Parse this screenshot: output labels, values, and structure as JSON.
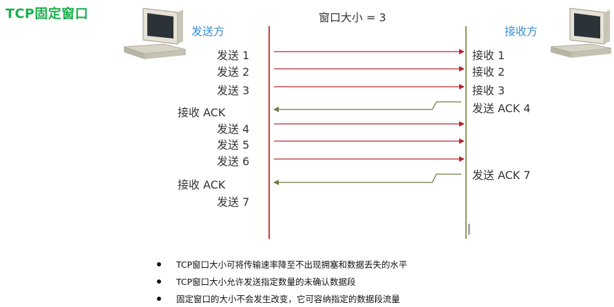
{
  "title": "TCP固定窗口",
  "sender": "发送方",
  "receiver": "接收方",
  "window_label": "窗口大小 = 3",
  "sender_labels": [
    "发送 1",
    "发送 2",
    "发送 3",
    "接收 ACK",
    "发送 4",
    "发送 5",
    "发送 6",
    "接收 ACK",
    "发送 7"
  ],
  "receiver_labels": [
    "接收 1",
    "接收 2",
    "接收 3",
    "发送 ACK 4",
    "发送 ACK 7"
  ],
  "bullets": [
    "TCP窗口大小可将传输速率降至不出现拥塞和数据丢失的水平",
    "TCP窗口大小允许发送指定数量的未确认数据段",
    "固定窗口的大小不会发生改变，它可容纳指定的数据段流量"
  ],
  "colors": {
    "title": "#17b04a",
    "role": "#3a8fd0",
    "sender_line": "#c43a3a",
    "receiver_line": "#8a9a5e",
    "data_arrow": "#b8242c",
    "ack_arrow": "#6f7a42"
  },
  "icons": [
    "computer-icon-sender",
    "computer-icon-receiver"
  ]
}
